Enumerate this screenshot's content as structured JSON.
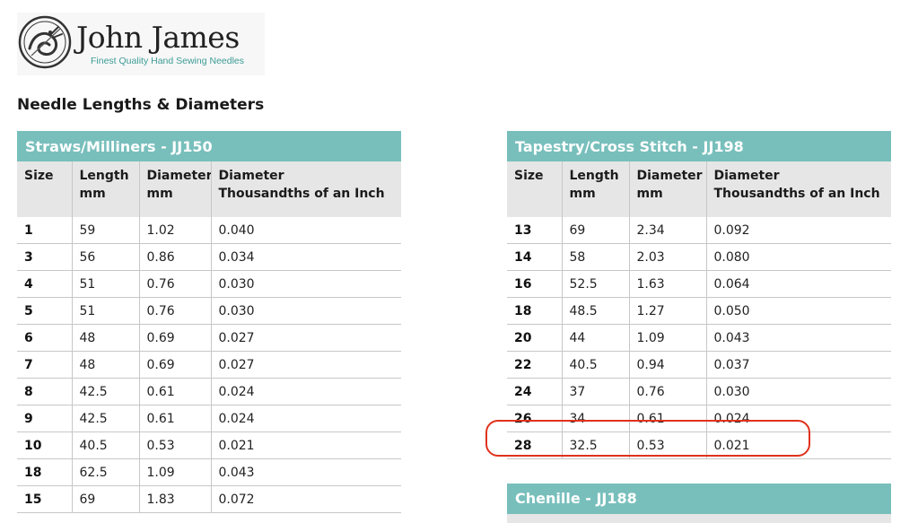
{
  "logo": {
    "name": "John James",
    "tagline": "Finest Quality Hand Sewing Needles"
  },
  "page_title": "Needle Lengths & Diameters",
  "colors": {
    "header_teal": "#78bfbc",
    "column_header_grey": "#e6e6e6",
    "highlight_red": "#e0321c",
    "tagline_teal": "#3d9c96"
  },
  "columns": {
    "size": "Size",
    "length": "Length",
    "length_unit": "mm",
    "diameter": "Diameter",
    "diameter_unit": "mm",
    "diameter_in": "Diameter",
    "diameter_in_unit": "Thousandths of an Inch"
  },
  "tables": [
    {
      "title": "Straws/Milliners - JJ150",
      "rows": [
        [
          "1",
          "59",
          "1.02",
          "0.040"
        ],
        [
          "3",
          "56",
          "0.86",
          "0.034"
        ],
        [
          "4",
          "51",
          "0.76",
          "0.030"
        ],
        [
          "5",
          "51",
          "0.76",
          "0.030"
        ],
        [
          "6",
          "48",
          "0.69",
          "0.027"
        ],
        [
          "7",
          "48",
          "0.69",
          "0.027"
        ],
        [
          "8",
          "42.5",
          "0.61",
          "0.024"
        ],
        [
          "9",
          "42.5",
          "0.61",
          "0.024"
        ],
        [
          "10",
          "40.5",
          "0.53",
          "0.021"
        ],
        [
          "18",
          "62.5",
          "1.09",
          "0.043"
        ],
        [
          "15",
          "69",
          "1.83",
          "0.072"
        ]
      ]
    },
    {
      "title": "Tapestry/Cross Stitch - JJ198",
      "rows": [
        [
          "13",
          "69",
          "2.34",
          "0.092"
        ],
        [
          "14",
          "58",
          "2.03",
          "0.080"
        ],
        [
          "16",
          "52.5",
          "1.63",
          "0.064"
        ],
        [
          "18",
          "48.5",
          "1.27",
          "0.050"
        ],
        [
          "20",
          "44",
          "1.09",
          "0.043"
        ],
        [
          "22",
          "40.5",
          "0.94",
          "0.037"
        ],
        [
          "24",
          "37",
          "0.76",
          "0.030"
        ],
        [
          "26",
          "34",
          "0.61",
          "0.024"
        ],
        [
          "28",
          "32.5",
          "0.53",
          "0.021"
        ]
      ]
    },
    {
      "title": "Chenille - JJ188"
    }
  ]
}
